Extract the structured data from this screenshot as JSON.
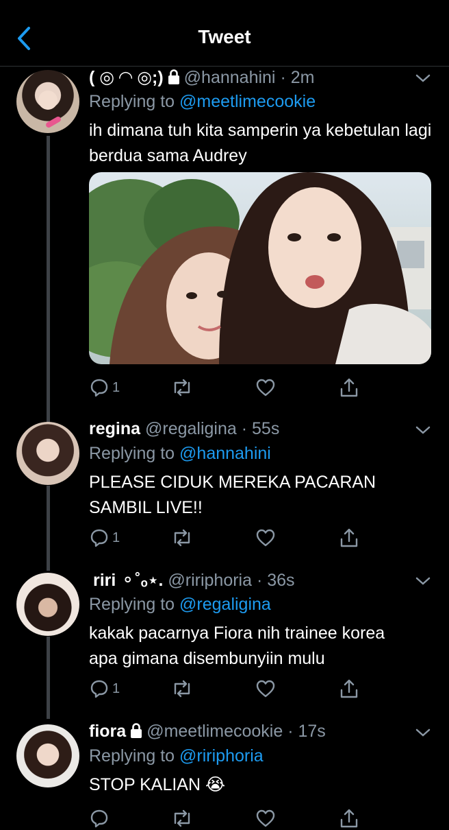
{
  "header": {
    "title": "Tweet"
  },
  "tweets": [
    {
      "name": "( ◎ ◠ ◎;)",
      "locked": true,
      "handle": "@hannahini",
      "time": "· 2m",
      "reply_prefix": "Replying to",
      "reply_to": "@meetlimecookie",
      "text": "ih dimana tuh kita samperin ya kebetulan lagi berdua sama Audrey",
      "reply_count": "1"
    },
    {
      "name": "regina",
      "handle": "@regaligina",
      "time": "· 55s",
      "reply_prefix": "Replying to",
      "reply_to": "@hannahini",
      "text": "PLEASE CIDUK MEREKA PACARAN SAMBIL LIVE!!",
      "reply_count": "1"
    },
    {
      "name": "riri ⚬˚ₒ⋆.",
      "handle": "@ririphoria",
      "time": "· 36s",
      "reply_prefix": "Replying to",
      "reply_to": "@regaligina",
      "text": "kakak pacarnya Fiora nih trainee korea apa gimana disembunyiin mulu",
      "reply_count": "1"
    },
    {
      "name": "fiora",
      "locked": true,
      "handle": "@meetlimecookie",
      "time": "· 17s",
      "reply_prefix": "Replying to",
      "reply_to": "@ririphoria",
      "text": "STOP KALIAN 😭"
    }
  ],
  "colors": {
    "background": "#000000",
    "secondary_text": "#8b98a5",
    "link": "#1d9bf0",
    "thread_line": "#3d4146"
  },
  "icons": [
    "back-chevron-icon",
    "caret-down-icon",
    "reply-icon",
    "retweet-icon",
    "like-icon",
    "share-icon",
    "lock-icon"
  ]
}
